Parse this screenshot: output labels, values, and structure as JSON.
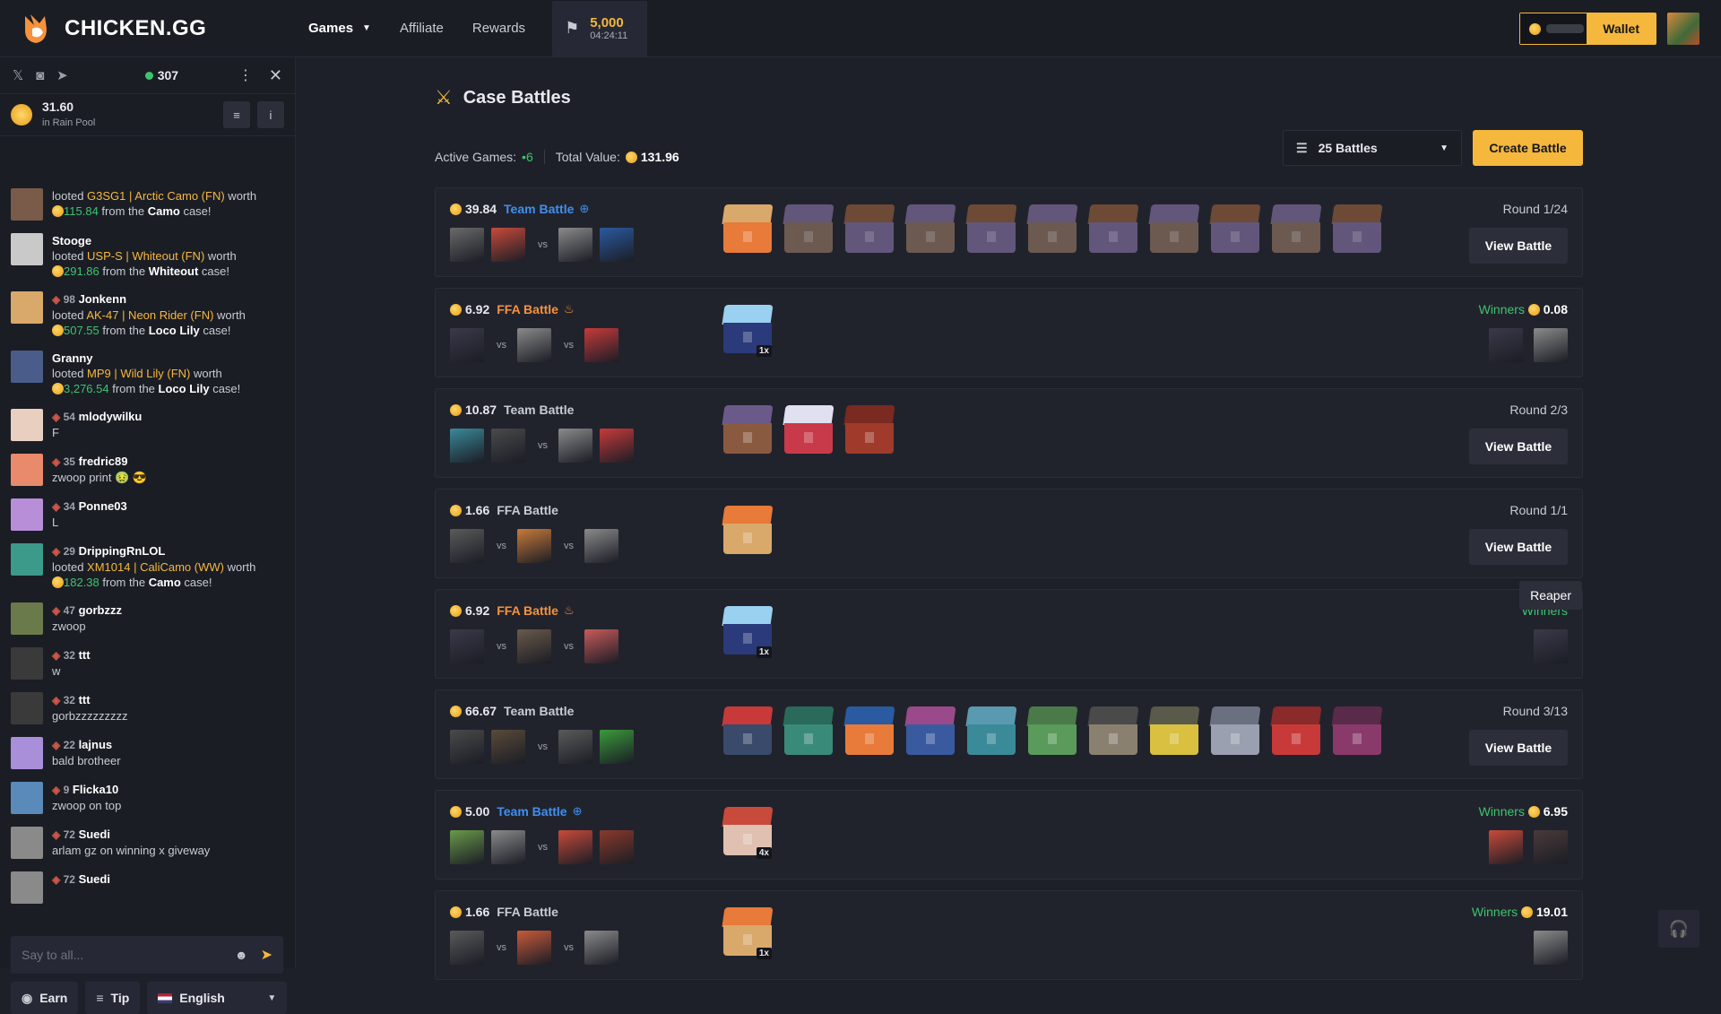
{
  "brand": {
    "name": "CHICKEN.GG"
  },
  "nav": {
    "games": "Games",
    "affiliate": "Affiliate",
    "rewards": "Rewards"
  },
  "event": {
    "amount": "5,000",
    "timer": "04:24:11"
  },
  "wallet": {
    "label": "Wallet"
  },
  "sidebar": {
    "online": "307",
    "rain": {
      "amount": "31.60",
      "label": "in Rain Pool"
    },
    "messages": [
      {
        "type": "loot",
        "user": "",
        "pre": "looted",
        "item": "G3SG1 | Arctic Camo (FN)",
        "worth": "worth",
        "value": "115.84",
        "from": "from the",
        "case": "Camo",
        "suf": "case!",
        "avatar": "#7a5a48"
      },
      {
        "type": "loot",
        "user": "Stooge",
        "pre": "looted",
        "item": "USP-S | Whiteout (FN)",
        "worth": "worth",
        "value": "291.86",
        "from": "from the",
        "case": "Whiteout",
        "suf": "case!",
        "avatar": "#c9c9c9"
      },
      {
        "type": "loot",
        "level": "98",
        "user": "Jonkenn",
        "pre": "looted",
        "item": "AK-47 | Neon Rider (FN)",
        "worth": "worth",
        "value": "507.55",
        "from": "from the",
        "case": "Loco Lily",
        "suf": "case!",
        "avatar": "#d9a86b"
      },
      {
        "type": "loot",
        "user": "Granny",
        "pre": "looted",
        "item": "MP9 | Wild Lily (FN)",
        "worth": "worth",
        "value": "3,276.54",
        "from": "from the",
        "case": "Loco Lily",
        "suf": "case!",
        "avatar": "#4a5d8a"
      },
      {
        "type": "text",
        "level": "54",
        "user": "mlodywilku",
        "text": "F",
        "avatar": "#e8cfc0"
      },
      {
        "type": "text",
        "level": "35",
        "user": "fredric89",
        "text": "zwoop print 🤢 😎",
        "avatar": "#e88a6b"
      },
      {
        "type": "text",
        "level": "34",
        "user": "Ponne03",
        "text": "L",
        "avatar": "#b98ed9"
      },
      {
        "type": "loot",
        "level": "29",
        "user": "DrippingRnLOL",
        "pre": "looted",
        "item": "XM1014 | CaliCamo (WW)",
        "worth": "worth",
        "value": "182.38",
        "from": "from the",
        "case": "Camo",
        "suf": "case!",
        "avatar": "#3b9a8a"
      },
      {
        "type": "text",
        "level": "47",
        "user": "gorbzzz",
        "text": "zwoop",
        "avatar": "#6b7a4a"
      },
      {
        "type": "text",
        "level": "32",
        "user": "ttt",
        "text": "w",
        "avatar": "#3a3a3a"
      },
      {
        "type": "text",
        "level": "32",
        "user": "ttt",
        "text": "gorbzzzzzzzzz",
        "avatar": "#3a3a3a"
      },
      {
        "type": "text",
        "level": "22",
        "user": "lajnus",
        "text": "bald brotheer",
        "avatar": "#a98ed9"
      },
      {
        "type": "text",
        "level": "9",
        "user": "Flicka10",
        "text": "zwoop on top",
        "avatar": "#5a8ab9"
      },
      {
        "type": "text",
        "level": "72",
        "user": "Suedi",
        "text": "arlam gz on winning x giveway",
        "avatar": "#8a8a8a"
      },
      {
        "type": "text",
        "level": "72",
        "user": "Suedi",
        "text": "",
        "avatar": "#8a8a8a"
      }
    ],
    "input_placeholder": "Say to all...",
    "earn": "Earn",
    "tip": "Tip",
    "language": "English"
  },
  "page": {
    "title": "Case Battles",
    "active_label": "Active Games:",
    "active_value": "6",
    "total_label": "Total Value:",
    "total_value": "131.96",
    "filter": "25 Battles",
    "create": "Create Battle"
  },
  "battles": [
    {
      "value": "39.84",
      "type": "Team Battle",
      "style": "blue",
      "tag": "team-icon",
      "right": "Round 1/24",
      "action": "View Battle",
      "cases": 11,
      "qty": ""
    },
    {
      "value": "6.92",
      "type": "FFA Battle",
      "style": "orange",
      "tag": "fire-icon",
      "winners": "Winners",
      "win_value": "0.08",
      "cases": 1,
      "qty": "1x"
    },
    {
      "value": "10.87",
      "type": "Team Battle",
      "style": "plain",
      "tag": "",
      "right": "Round 2/3",
      "action": "View Battle",
      "cases": 3,
      "qty": ""
    },
    {
      "value": "1.66",
      "type": "FFA Battle",
      "style": "plain",
      "tag": "",
      "right": "Round 1/1",
      "action": "View Battle",
      "cases": 1,
      "qty": ""
    },
    {
      "value": "6.92",
      "type": "FFA Battle",
      "style": "orange",
      "tag": "fire-icon",
      "winners": "Winners",
      "win_value": "",
      "tooltip": "Reaper",
      "cases": 1,
      "qty": "1x"
    },
    {
      "value": "66.67",
      "type": "Team Battle",
      "style": "plain",
      "tag": "",
      "right": "Round 3/13",
      "action": "View Battle",
      "cases": 11,
      "qty": ""
    },
    {
      "value": "5.00",
      "type": "Team Battle",
      "style": "blue",
      "tag": "team-icon",
      "winners": "Winners",
      "win_value": "6.95",
      "cases": 1,
      "qty": "4x"
    },
    {
      "value": "1.66",
      "type": "FFA Battle",
      "style": "plain",
      "tag": "",
      "winners": "Winners",
      "win_value": "19.01",
      "cases": 1,
      "qty": "1x"
    }
  ],
  "icons": [
    "x-icon",
    "discord-icon",
    "telegram-icon",
    "kebab-menu-icon",
    "close-icon",
    "stack-icon",
    "info-icon",
    "swords-icon",
    "filter-icon",
    "headset-icon",
    "emoji-icon",
    "send-icon"
  ]
}
